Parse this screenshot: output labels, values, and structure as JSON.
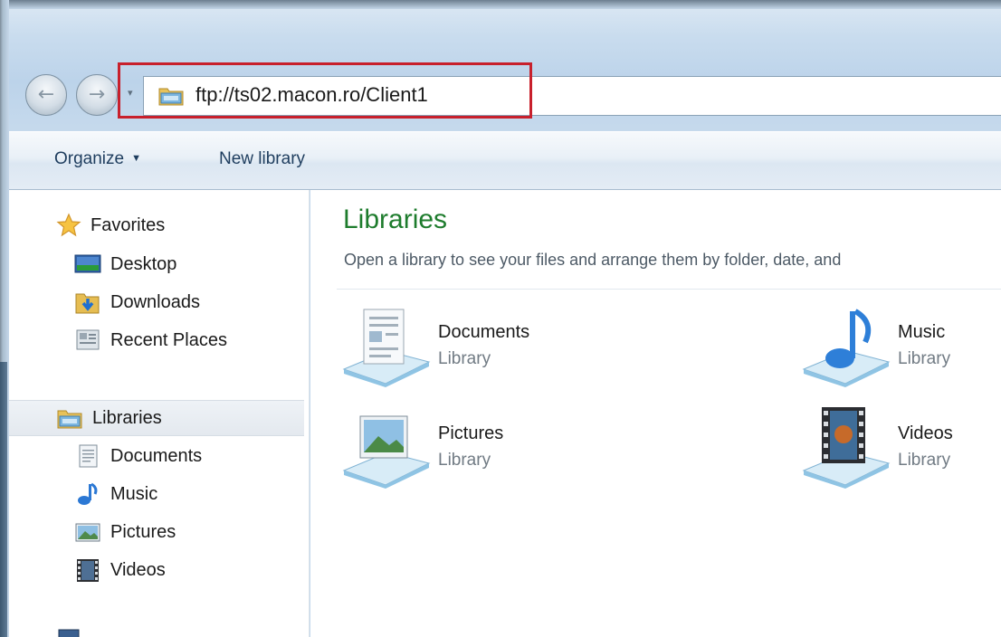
{
  "address_bar": {
    "path": "ftp://ts02.macon.ro/Client1"
  },
  "toolbar": {
    "organize_label": "Organize",
    "new_library_label": "New library"
  },
  "nav_pane": {
    "favorites": {
      "label": "Favorites",
      "items": [
        {
          "label": "Desktop",
          "icon": "desktop-icon"
        },
        {
          "label": "Downloads",
          "icon": "downloads-icon"
        },
        {
          "label": "Recent Places",
          "icon": "recent-places-icon"
        }
      ]
    },
    "libraries": {
      "label": "Libraries",
      "items": [
        {
          "label": "Documents",
          "icon": "documents-icon"
        },
        {
          "label": "Music",
          "icon": "music-icon"
        },
        {
          "label": "Pictures",
          "icon": "pictures-icon"
        },
        {
          "label": "Videos",
          "icon": "videos-icon"
        }
      ]
    }
  },
  "content": {
    "title": "Libraries",
    "subtitle": "Open a library to see your files and arrange them by folder, date, and",
    "libraries": [
      {
        "name": "Documents",
        "type": "Library",
        "icon": "documents-library-icon"
      },
      {
        "name": "Music",
        "type": "Library",
        "icon": "music-library-icon"
      },
      {
        "name": "Pictures",
        "type": "Library",
        "icon": "pictures-library-icon"
      },
      {
        "name": "Videos",
        "type": "Library",
        "icon": "videos-library-icon"
      }
    ]
  },
  "colors": {
    "title_green": "#1e7c2d",
    "highlight_red": "#c8202c",
    "toolbar_text": "#1e3d5e"
  }
}
